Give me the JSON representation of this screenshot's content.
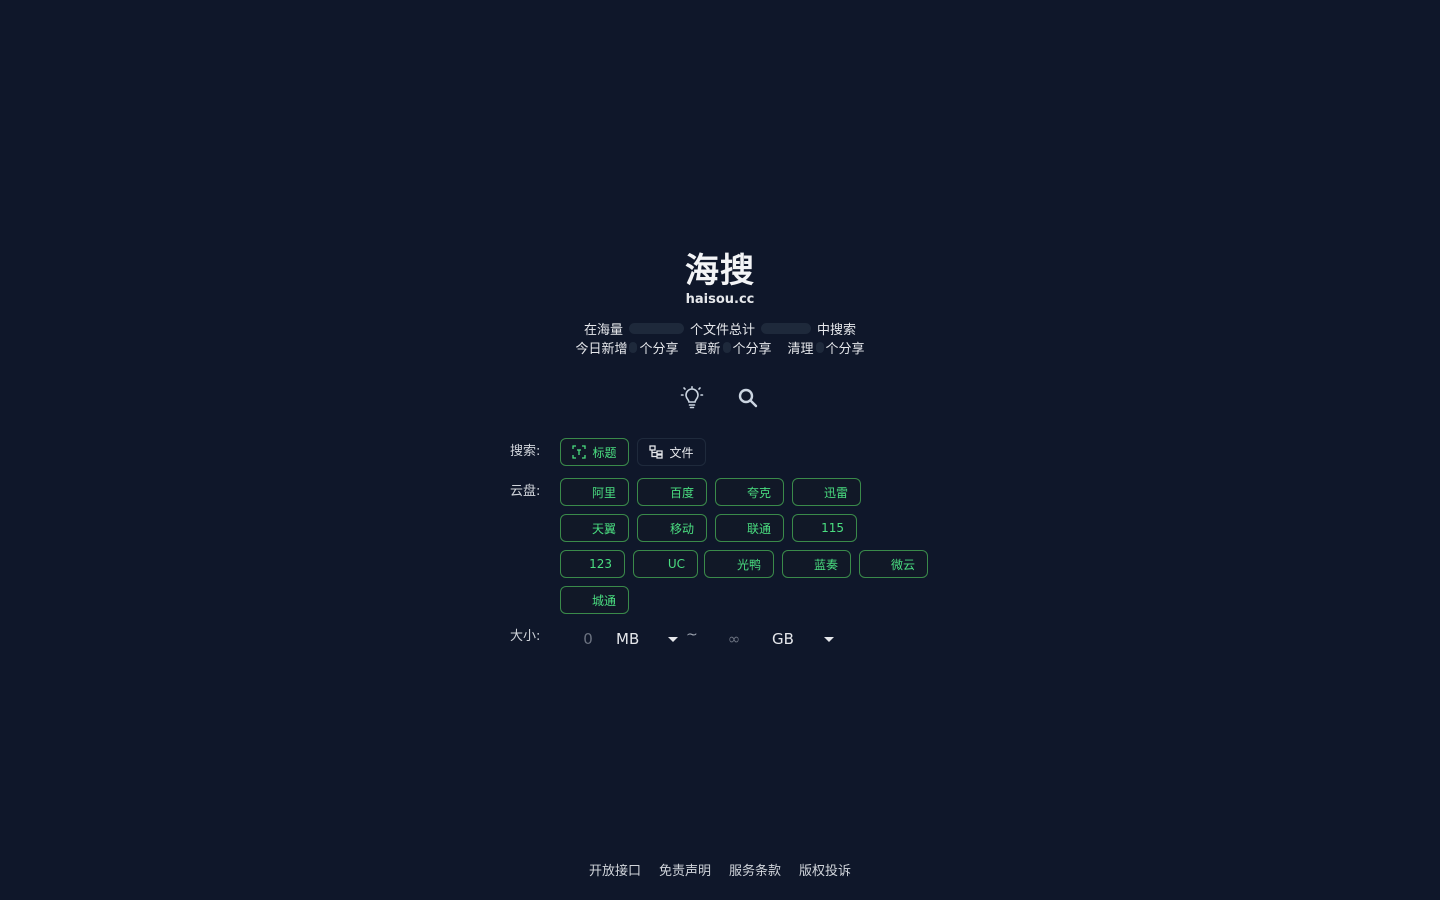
{
  "brand": {
    "title": "海搜",
    "domain": "haisou.cc"
  },
  "stats": {
    "line1": {
      "prefix": "在海量",
      "middle": "个文件总计",
      "suffix": "中搜索"
    },
    "line2": {
      "today": "今日新增",
      "update": "更新",
      "clean": "清理",
      "unit": "个分享"
    }
  },
  "icons": {
    "theme": "lightbulb-icon",
    "search": "search-icon"
  },
  "search_mode": {
    "label": "搜索:",
    "options": [
      {
        "label": "标题",
        "icon": "scan-title-icon",
        "active": true
      },
      {
        "label": "文件",
        "icon": "file-tree-icon",
        "active": false
      }
    ]
  },
  "cloud": {
    "label": "云盘:",
    "rows": [
      [
        "阿里",
        "百度",
        "夸克",
        "迅雷"
      ],
      [
        "天翼",
        "移动",
        "联通",
        "115"
      ],
      [
        "123",
        "UC",
        "光鸭",
        "蓝奏",
        "微云"
      ],
      [
        "城通"
      ]
    ]
  },
  "size": {
    "label": "大小:",
    "min": "0",
    "min_unit": "MB",
    "separator": "~",
    "max": "∞",
    "max_unit": "GB"
  },
  "footer": {
    "links": [
      "开放接口",
      "免责声明",
      "服务条款",
      "版权投诉"
    ]
  },
  "colors": {
    "background": "#0f172a",
    "accent": "#4ade80",
    "chip_border": "#3a8a4a"
  }
}
